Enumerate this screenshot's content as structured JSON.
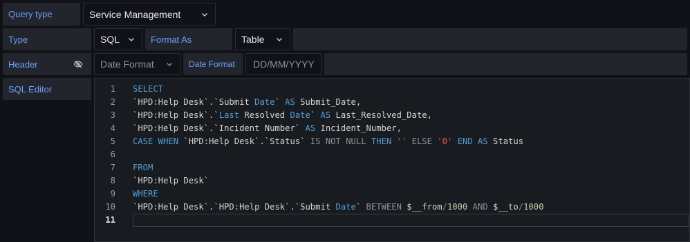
{
  "query_type": {
    "label": "Query type",
    "value": "Service Management"
  },
  "type_row": {
    "type_label": "Type",
    "type_value": "SQL",
    "format_label": "Format As",
    "format_value": "Table"
  },
  "header_row": {
    "header_label": "Header",
    "date_format_select": "Date Format",
    "date_format_label": "Date Format",
    "date_format_placeholder": "DD/MM/YYYY"
  },
  "sql_editor": {
    "label": "SQL Editor",
    "line_numbers": [
      "1",
      "2",
      "3",
      "4",
      "5",
      "6",
      "7",
      "8",
      "9",
      "10",
      "11"
    ],
    "active_line": "11",
    "lines": [
      [
        {
          "t": "SELECT",
          "c": "kw"
        }
      ],
      [
        {
          "t": "`HPD:Help Desk`.`Submit ",
          "c": "plain"
        },
        {
          "t": "Date",
          "c": "kw"
        },
        {
          "t": "` ",
          "c": "plain"
        },
        {
          "t": "AS",
          "c": "kw"
        },
        {
          "t": " Submit_Date,",
          "c": "plain"
        }
      ],
      [
        {
          "t": "`HPD:Help Desk`.`",
          "c": "plain"
        },
        {
          "t": "Last",
          "c": "kw"
        },
        {
          "t": " Resolved ",
          "c": "plain"
        },
        {
          "t": "Date",
          "c": "kw"
        },
        {
          "t": "` ",
          "c": "plain"
        },
        {
          "t": "AS",
          "c": "kw"
        },
        {
          "t": " Last_Resolved_Date,",
          "c": "plain"
        }
      ],
      [
        {
          "t": "`HPD:Help Desk`.`Incident Number` ",
          "c": "plain"
        },
        {
          "t": "AS",
          "c": "kw"
        },
        {
          "t": " Incident_Number,",
          "c": "plain"
        }
      ],
      [
        {
          "t": "CASE WHEN",
          "c": "kw"
        },
        {
          "t": " `HPD:Help Desk`.`Status` ",
          "c": "plain"
        },
        {
          "t": "IS NOT NULL",
          "c": "op"
        },
        {
          "t": " ",
          "c": "plain"
        },
        {
          "t": "THEN",
          "c": "kw"
        },
        {
          "t": " ",
          "c": "plain"
        },
        {
          "t": "''",
          "c": "str"
        },
        {
          "t": " ",
          "c": "plain"
        },
        {
          "t": "ELSE",
          "c": "op"
        },
        {
          "t": " ",
          "c": "plain"
        },
        {
          "t": "'0'",
          "c": "str"
        },
        {
          "t": " ",
          "c": "plain"
        },
        {
          "t": "END AS",
          "c": "kw"
        },
        {
          "t": " Status",
          "c": "plain"
        }
      ],
      [
        {
          "t": "",
          "c": "plain"
        }
      ],
      [
        {
          "t": "FROM",
          "c": "kw"
        }
      ],
      [
        {
          "t": "`HPD:Help Desk`",
          "c": "plain"
        }
      ],
      [
        {
          "t": "WHERE",
          "c": "kw"
        }
      ],
      [
        {
          "t": "`HPD:Help Desk`.`HPD:Help Desk`.`Submit ",
          "c": "plain"
        },
        {
          "t": "Date",
          "c": "kw"
        },
        {
          "t": "` ",
          "c": "plain"
        },
        {
          "t": "BETWEEN",
          "c": "op"
        },
        {
          "t": " $__from",
          "c": "plain"
        },
        {
          "t": "/",
          "c": "op"
        },
        {
          "t": "1000",
          "c": "num"
        },
        {
          "t": " ",
          "c": "plain"
        },
        {
          "t": "AND",
          "c": "op"
        },
        {
          "t": " $__to",
          "c": "plain"
        },
        {
          "t": "/",
          "c": "op"
        },
        {
          "t": "1000",
          "c": "num"
        }
      ],
      [
        {
          "t": "",
          "c": "plain"
        }
      ]
    ]
  },
  "icons": {
    "chevron": "chevron-down-icon",
    "eye_off": "eye-off-icon"
  },
  "colors": {
    "background": "#111217",
    "label_bg": "#22252b",
    "label_text": "#6e9fff",
    "keyword": "#569cd6",
    "string": "#e05a5a"
  }
}
